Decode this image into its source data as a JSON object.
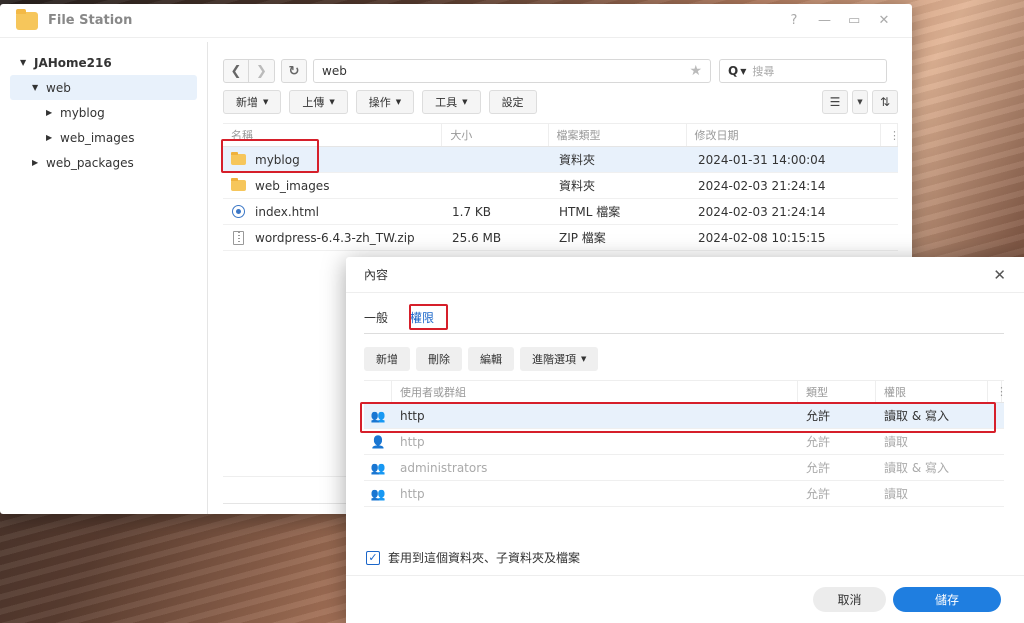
{
  "window": {
    "title": "File Station",
    "controls": [
      "?",
      "—",
      "▭",
      "✕"
    ]
  },
  "sidebar": {
    "root": "JAHome216",
    "items": [
      {
        "label": "web",
        "level": 1,
        "expanded": true,
        "selected": true
      },
      {
        "label": "myblog",
        "level": 2
      },
      {
        "label": "web_images",
        "level": 2
      },
      {
        "label": "web_packages",
        "level": 1
      }
    ]
  },
  "nav": {
    "path": "web",
    "search_placeholder": "搜尋"
  },
  "toolbar": {
    "buttons": [
      "新增",
      "上傳",
      "操作",
      "工具",
      "設定"
    ]
  },
  "file_table": {
    "headers": [
      "名稱",
      "大小",
      "檔案類型",
      "修改日期"
    ],
    "rows": [
      {
        "name": "myblog",
        "size": "",
        "type": "資料夾",
        "date": "2024-01-31 14:00:04",
        "icon": "folder-icon"
      },
      {
        "name": "web_images",
        "size": "",
        "type": "資料夾",
        "date": "2024-02-03 21:24:14",
        "icon": "folder-icon"
      },
      {
        "name": "index.html",
        "size": "1.7 KB",
        "type": "HTML 檔案",
        "date": "2024-02-03 21:24:14",
        "icon": "html-file-icon"
      },
      {
        "name": "wordpress-6.4.3-zh_TW.zip",
        "size": "25.6 MB",
        "type": "ZIP 檔案",
        "date": "2024-02-08 10:15:15",
        "icon": "zip-file-icon"
      }
    ]
  },
  "dialog": {
    "title": "內容",
    "tabs": [
      "一般",
      "權限"
    ],
    "active_tab": "權限",
    "tools": [
      "新增",
      "刪除",
      "編輯",
      "進階選項"
    ],
    "headers": [
      "使用者或群組",
      "類型",
      "權限"
    ],
    "rows": [
      {
        "name": "http",
        "type": "允許",
        "perm": "讀取 & 寫入"
      },
      {
        "name": "http",
        "type": "允許",
        "perm": "讀取"
      },
      {
        "name": "administrators",
        "type": "允許",
        "perm": "讀取 & 寫入"
      },
      {
        "name": "http",
        "type": "允許",
        "perm": "讀取"
      }
    ],
    "apply_checkbox": "套用到這個資料夾、子資料夾及檔案",
    "cancel": "取消",
    "save": "儲存"
  },
  "colors": {
    "accent": "#1f7ee0",
    "highlight": "#d61f2a",
    "selection": "#e8f1fb"
  }
}
